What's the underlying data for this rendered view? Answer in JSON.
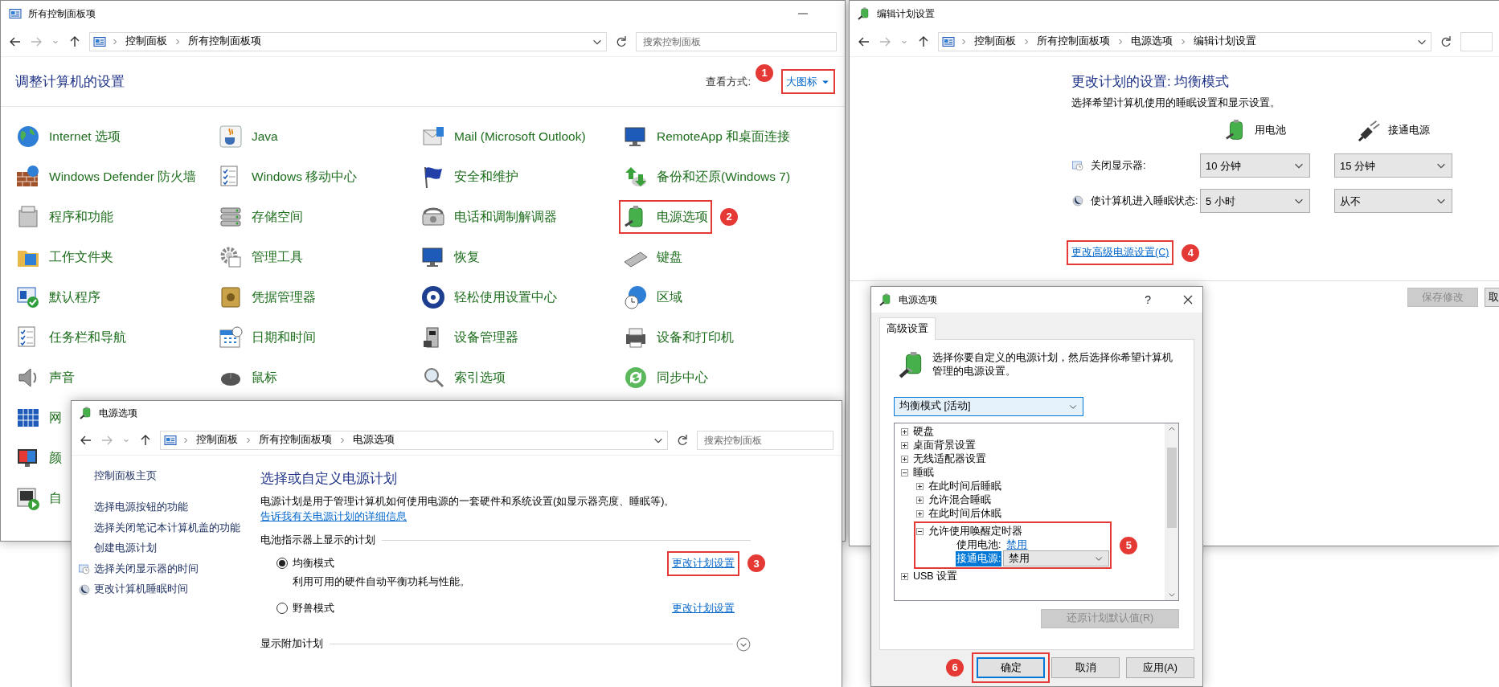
{
  "control_panel": {
    "title": "所有控制面板项",
    "breadcrumbs": [
      "控制面板",
      "所有控制面板项"
    ],
    "search": {
      "placeholder": "搜索控制面板"
    },
    "heading": "调整计算机的设置",
    "view_by_label": "查看方式:",
    "view_by_value": "大图标",
    "rows": [
      [
        "Internet 选项",
        "Java",
        "Mail (Microsoft Outlook)",
        "RemoteApp 和桌面连接"
      ],
      [
        "Windows Defender 防火墙",
        "Windows 移动中心",
        "安全和维护",
        "备份和还原(Windows 7)"
      ],
      [
        "程序和功能",
        "存储空间",
        "电话和调制解调器",
        "电源选项"
      ],
      [
        "工作文件夹",
        "管理工具",
        "恢复",
        "键盘"
      ],
      [
        "默认程序",
        "凭据管理器",
        "轻松使用设置中心",
        "区域"
      ],
      [
        "任务栏和导航",
        "日期和时间",
        "设备管理器",
        "设备和打印机"
      ],
      [
        "声音",
        "鼠标",
        "索引选项",
        "同步中心"
      ],
      [
        "网"
      ],
      [
        "颜"
      ],
      [
        "自"
      ]
    ]
  },
  "power_options": {
    "title": "电源选项",
    "breadcrumbs": [
      "控制面板",
      "所有控制面板项",
      "电源选项"
    ],
    "search": {
      "placeholder": "搜索控制面板"
    },
    "sidebar": [
      {
        "label": "控制面板主页"
      },
      {
        "label": "选择电源按钮的功能"
      },
      {
        "label": "选择关闭笔记本计算机盖的功能"
      },
      {
        "label": "创建电源计划"
      },
      {
        "label": "选择关闭显示器的时间"
      },
      {
        "label": "更改计算机睡眠时间"
      }
    ],
    "heading": "选择或自定义电源计划",
    "description": "电源计划是用于管理计算机如何使用电源的一套硬件和系统设置(如显示器亮度、睡眠等)。",
    "description_link": "告诉我有关电源计划的详细信息",
    "plans_heading": "电池指示器上显示的计划",
    "plans": [
      {
        "name": "均衡模式",
        "selected": true,
        "description": "利用可用的硬件自动平衡功耗与性能。",
        "link": "更改计划设置"
      },
      {
        "name": "野兽模式",
        "selected": false,
        "link": "更改计划设置"
      }
    ],
    "more_plans": "显示附加计划"
  },
  "edit_plan": {
    "title": "编辑计划设置",
    "breadcrumbs": [
      "控制面板",
      "所有控制面板项",
      "电源选项",
      "编辑计划设置"
    ],
    "heading": "更改计划的设置: 均衡模式",
    "subheading": "选择希望计算机使用的睡眠设置和显示设置。",
    "columns": [
      "用电池",
      "接通电源"
    ],
    "settings": [
      {
        "label": "关闭显示器:",
        "values": [
          "10 分钟",
          "15 分钟"
        ]
      },
      {
        "label": "使计算机进入睡眠状态:",
        "values": [
          "5 小时",
          "从不"
        ]
      }
    ],
    "advanced_link": "更改高级电源设置(C)",
    "buttons": [
      {
        "label": "保存修改",
        "disabled": true
      },
      {
        "label": "取",
        "disabled": false
      }
    ]
  },
  "dialog": {
    "title": "电源选项",
    "help": "?",
    "tabs": [
      {
        "label": "高级设置",
        "selected": true
      }
    ],
    "intro": "选择你要自定义的电源计划，然后选择你希望计算机管理的电源设置。",
    "plan": "均衡模式 [活动]",
    "tree": [
      {
        "kind": "group",
        "label": "硬盘",
        "expanded": false
      },
      {
        "kind": "group",
        "label": "桌面背景设置",
        "expanded": false
      },
      {
        "kind": "group",
        "label": "无线适配器设置",
        "expanded": false
      },
      {
        "kind": "group",
        "label": "睡眠",
        "expanded": true,
        "children": [
          {
            "kind": "group",
            "label": "在此时间后睡眠",
            "expanded": false
          },
          {
            "kind": "group",
            "label": "允许混合睡眠",
            "expanded": false
          },
          {
            "kind": "group",
            "label": "在此时间后休眠",
            "expanded": false
          },
          {
            "kind": "group",
            "label": "允许使用唤醒定时器",
            "expanded": true,
            "children": [
              {
                "kind": "setting",
                "label": "使用电池:",
                "value": "禁用",
                "selected": false
              },
              {
                "kind": "setting",
                "label": "接通电源:",
                "value": "禁用",
                "selected": true
              }
            ]
          }
        ]
      },
      {
        "kind": "group",
        "label": "USB 设置",
        "expanded": false
      }
    ],
    "restore_button": {
      "label": "还原计划默认值(R)",
      "disabled": true
    },
    "buttons": [
      {
        "label": "确定",
        "default": true
      },
      {
        "label": "取消",
        "default": false
      },
      {
        "label": "应用(A)",
        "default": false
      }
    ]
  },
  "annotations": [
    {
      "number": "1"
    },
    {
      "number": "2"
    },
    {
      "number": "3"
    },
    {
      "number": "4"
    },
    {
      "number": "5"
    },
    {
      "number": "6"
    }
  ]
}
